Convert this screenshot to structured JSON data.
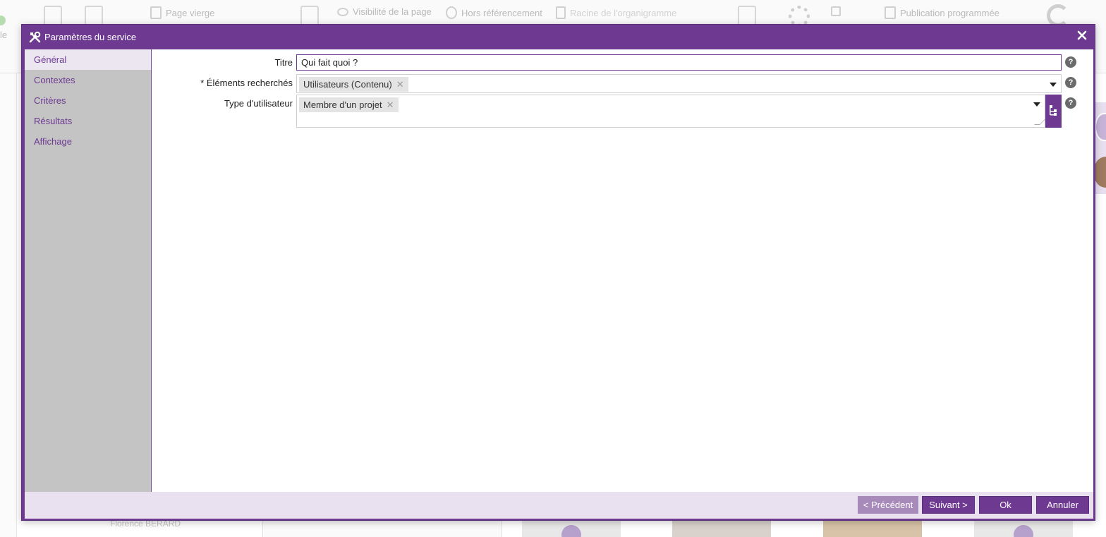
{
  "background": {
    "toolbar": {
      "items": [
        {
          "label": "Page vierge",
          "icon": "blank-page-icon"
        },
        {
          "label": "Visibilité de la page",
          "icon": "eye-icon"
        },
        {
          "label": "Hors référencement",
          "icon": "no-referencing-icon"
        },
        {
          "label": "Racine de l'organigramme",
          "icon": "org-chart-icon"
        },
        {
          "label": "Publication programmée",
          "icon": "calendar-icon"
        }
      ],
      "left_label": "le"
    },
    "person_name": "Florence BERARD"
  },
  "dialog": {
    "title": "Paramètres du service",
    "title_icon": "tools-icon",
    "close_icon": "close-icon",
    "sidebar": {
      "items": [
        {
          "label": "Général",
          "active": true
        },
        {
          "label": "Contextes",
          "active": false
        },
        {
          "label": "Critères",
          "active": false
        },
        {
          "label": "Résultats",
          "active": false
        },
        {
          "label": "Affichage",
          "active": false
        }
      ]
    },
    "form": {
      "title_field": {
        "label": "Titre",
        "value": "Qui fait quoi ?"
      },
      "searched_elements": {
        "label": "* Éléments recherchés",
        "tags": [
          "Utilisateurs (Contenu)"
        ]
      },
      "user_type": {
        "label": "Type d'utilisateur",
        "tags": [
          "Membre d'un projet"
        ]
      },
      "help_symbol": "?",
      "remove_symbol": "✕"
    },
    "footer": {
      "previous": "< Précédent",
      "next": "Suivant >",
      "ok": "Ok",
      "cancel": "Annuler"
    }
  },
  "colors": {
    "accent": "#6e3a91",
    "sidebar_bg": "#c4c4c4",
    "footer_bg": "#e9e0f0",
    "disabled_button": "#a78ab9"
  }
}
